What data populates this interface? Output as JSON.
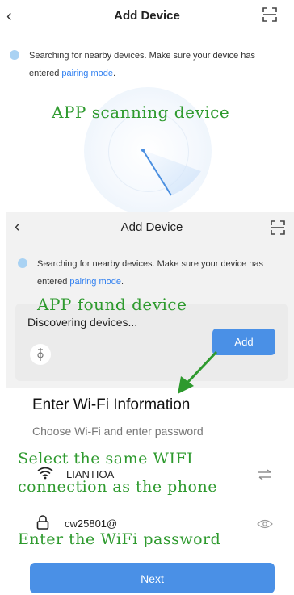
{
  "screen1": {
    "title": "Add Device",
    "back_icon": "chevron-left-icon",
    "scan_icon": "scan-icon",
    "message_prefix": "Searching for nearby devices. Make sure your device has entered ",
    "message_link": "pairing mode",
    "message_suffix": "."
  },
  "screen2": {
    "title": "Add Device",
    "message_prefix": "Searching for nearby devices. Make sure your device has entered ",
    "message_link": "pairing mode",
    "message_suffix": ".",
    "discovering_label": "Discovering devices...",
    "add_button": "Add"
  },
  "wifi_form": {
    "title": "Enter Wi-Fi Information",
    "subtitle": "Choose Wi-Fi and enter password",
    "ssid": "LIANTIOA",
    "password": "cw25801@",
    "next_button": "Next"
  },
  "annotations": {
    "scanning": "APP scanning  device",
    "found": "APP found device",
    "select_wifi_1": "Select the same WIFI",
    "select_wifi_2": "connection as the phone",
    "enter_password": "Enter the WiFi password"
  },
  "colors": {
    "accent": "#4a90e6",
    "link": "#2d7ef0",
    "annotation": "#2e9a2e"
  }
}
